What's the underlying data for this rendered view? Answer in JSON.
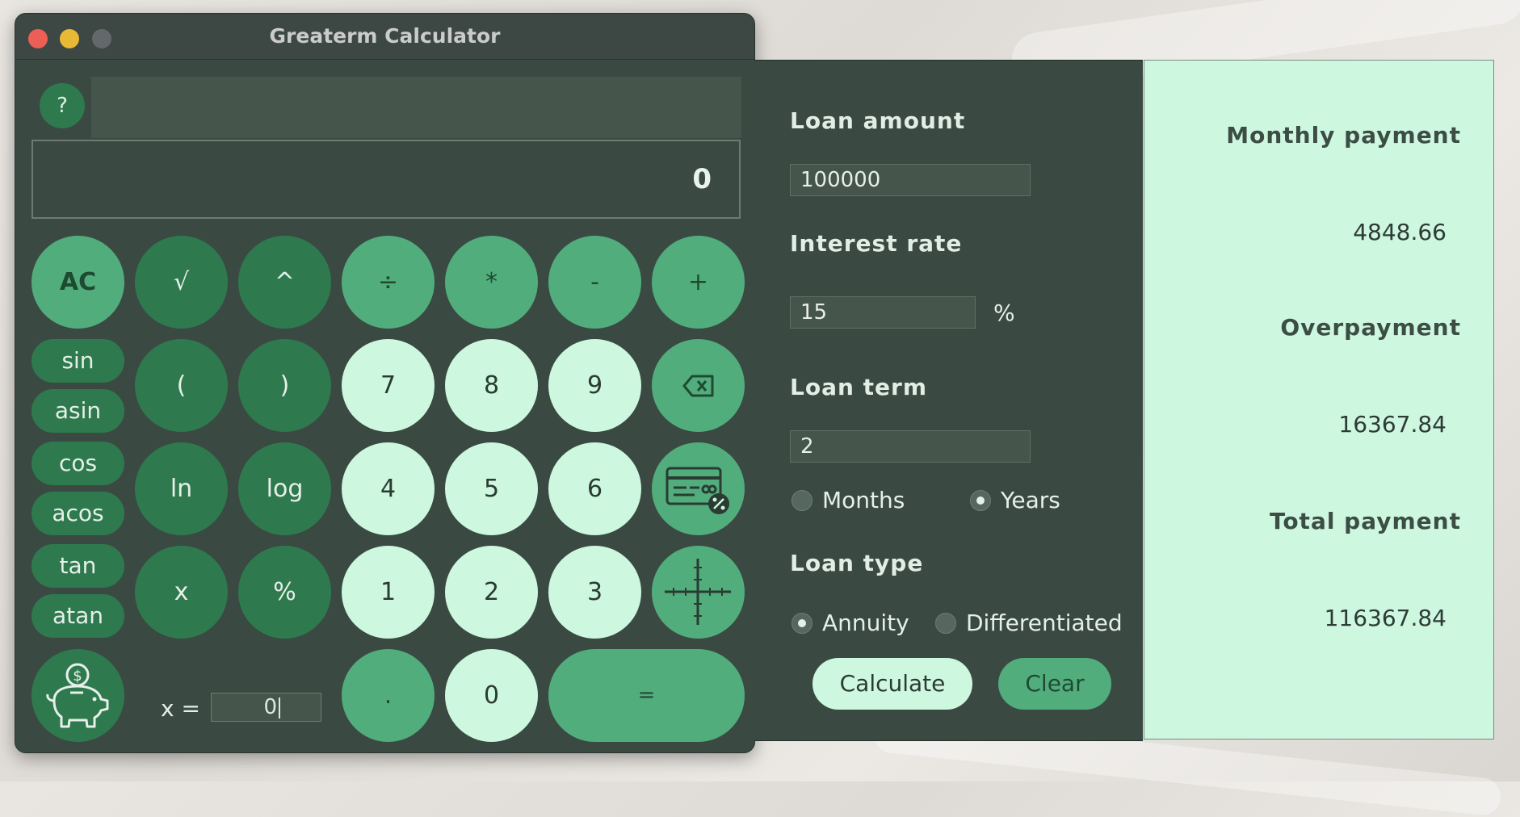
{
  "window": {
    "title": "Greaterm Calculator"
  },
  "calculator": {
    "help_label": "?",
    "expression": "",
    "display": "0",
    "buttons": {
      "ac": "AC",
      "sqrt": "√",
      "pow": "^",
      "div": "÷",
      "mul": "*",
      "sub": "-",
      "add": "+",
      "lparen": "(",
      "rparen": ")",
      "ln": "ln",
      "log": "log",
      "x": "x",
      "mod": "%",
      "d7": "7",
      "d8": "8",
      "d9": "9",
      "d4": "4",
      "d5": "5",
      "d6": "6",
      "d1": "1",
      "d2": "2",
      "d3": "3",
      "d0": "0",
      "dot": ".",
      "eq": "="
    },
    "trig": {
      "sin": "sin",
      "asin": "asin",
      "cos": "cos",
      "acos": "acos",
      "tan": "tan",
      "atan": "atan"
    },
    "x_label": "x =",
    "x_value": "0"
  },
  "credit": {
    "loan_amount_label": "Loan amount",
    "loan_amount": "100000",
    "interest_label": "Interest rate",
    "interest": "15",
    "percent": "%",
    "term_label": "Loan term",
    "term": "2",
    "months": "Months",
    "years": "Years",
    "term_unit_selected": "Years",
    "type_label": "Loan type",
    "annuity": "Annuity",
    "differentiated": "Differentiated",
    "type_selected": "Annuity",
    "calculate": "Calculate",
    "clear": "Clear"
  },
  "results": {
    "monthly_label": "Monthly payment",
    "monthly": "4848.66",
    "overpayment_label": "Overpayment",
    "overpayment": "16367.84",
    "total_label": "Total payment",
    "total": "116367.84"
  },
  "colors": {
    "dark_button": "#2e7a4e",
    "mid_button": "#52ad7d",
    "light_button": "#cdf7df",
    "panel": "#3a4a42",
    "results_bg": "#cdf7df"
  },
  "icons": {
    "backspace": "backspace-icon",
    "credit_calculator": "credit-card-percent-icon",
    "graph": "graph-axes-icon",
    "deposit": "piggy-bank-icon"
  }
}
